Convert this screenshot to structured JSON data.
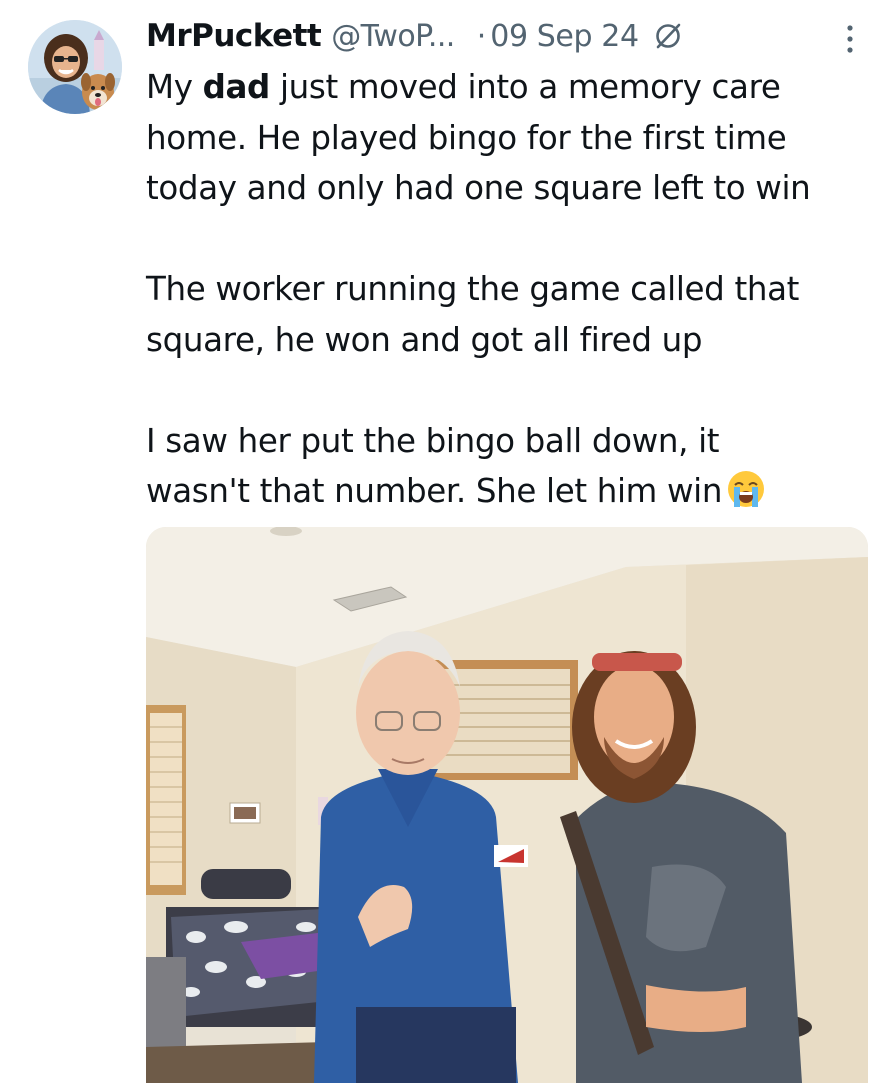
{
  "author": {
    "display_name": "MrPuckett",
    "handle": "@TwoP...",
    "separator": "·",
    "date": "09 Sep 24"
  },
  "tweet": {
    "line1_pre": "My ",
    "line1_bold": "dad",
    "line1_post": " just moved into a memory care",
    "line2": "home. He played bingo for the first time",
    "line3": "today and only had one square left to win",
    "line4": "The worker running the game called that",
    "line5": "square, he won and got all fired up",
    "line6": "I saw her put the bingo ball down, it",
    "line7": "wasn't that number. She let him win"
  },
  "icons": {
    "avatar": "avatar-image",
    "grok": "grok-icon",
    "more": "more-options-icon",
    "emoji": "loudly-crying-face-emoji"
  },
  "colors": {
    "text_primary": "#0f1419",
    "text_secondary": "#536471",
    "background": "#ffffff"
  }
}
